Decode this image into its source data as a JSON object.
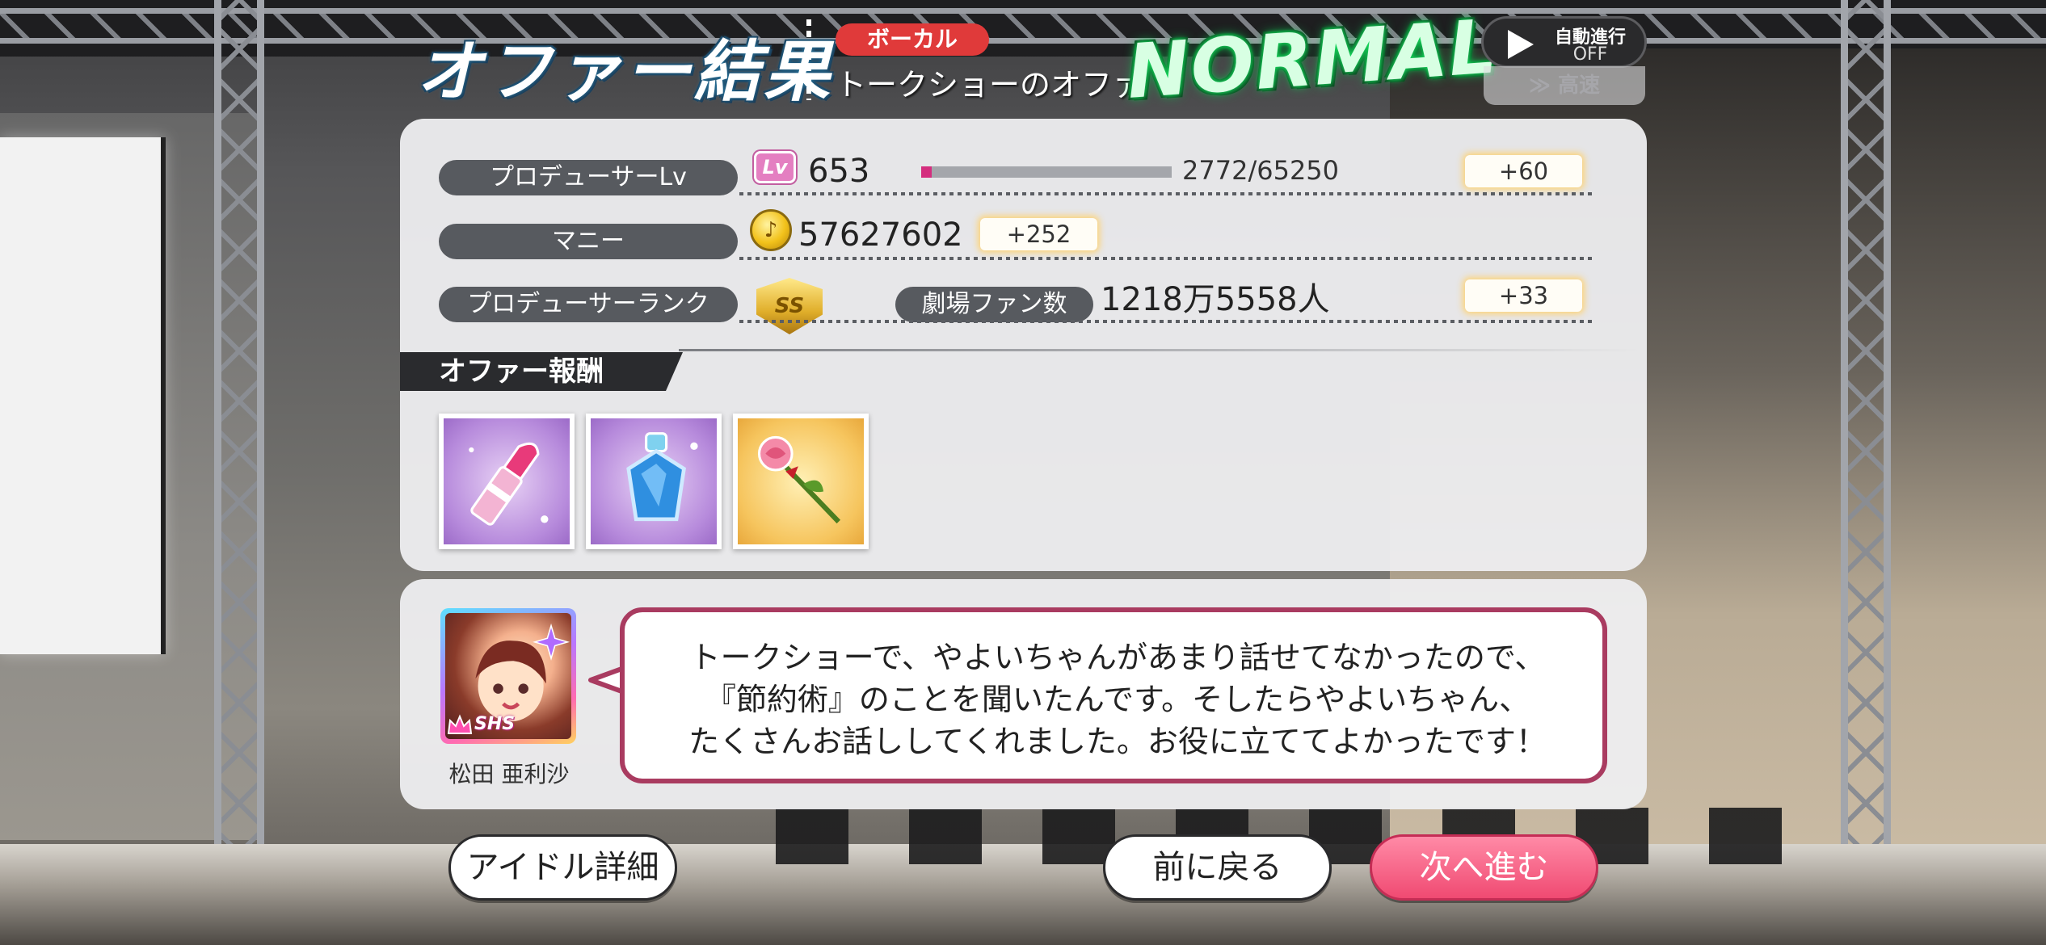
{
  "header": {
    "title": "オファー結果",
    "category": "ボーカル",
    "offer_name": "トークショーのオファ",
    "difficulty": "NORMAL",
    "auto_label": "自動進行",
    "auto_state": "OFF",
    "speed_label": "≫ 高速"
  },
  "stats": {
    "producer_lv": {
      "label": "プロデューサーLv",
      "icon": "Lv",
      "value": "653",
      "xp": "2772/65250",
      "xp_fraction": 0.0425,
      "gain": "+60"
    },
    "money": {
      "label": "マニー",
      "value": "57627602",
      "gain": "+252"
    },
    "rank": {
      "label": "プロデューサーランク",
      "icon_text": "SS"
    },
    "fans": {
      "label": "劇場ファン数",
      "value": "1218万5558人",
      "gain": "+33"
    }
  },
  "rewards": {
    "header": "オファー報酬",
    "items": [
      "lipstick-icon",
      "perfume-bottle-icon",
      "rose-icon"
    ]
  },
  "dialogue": {
    "idol_name": "松田 亜利沙",
    "rarity": "SHS",
    "lines": [
      "トークショーで、やよいちゃんがあまり話せてなかったので、",
      "『節約術』のことを聞いたんです。そしたらやよいちゃん、",
      "たくさんお話ししてくれました。お役に立ててよかったです！"
    ]
  },
  "buttons": {
    "idol_detail": "アイドル詳細",
    "back": "前に戻る",
    "next": "次へ進む"
  },
  "colors": {
    "accent_pink": "#f04a72",
    "category_red": "#e03a3a",
    "difficulty_green": "#19e060",
    "speech_border": "#a93b60"
  }
}
